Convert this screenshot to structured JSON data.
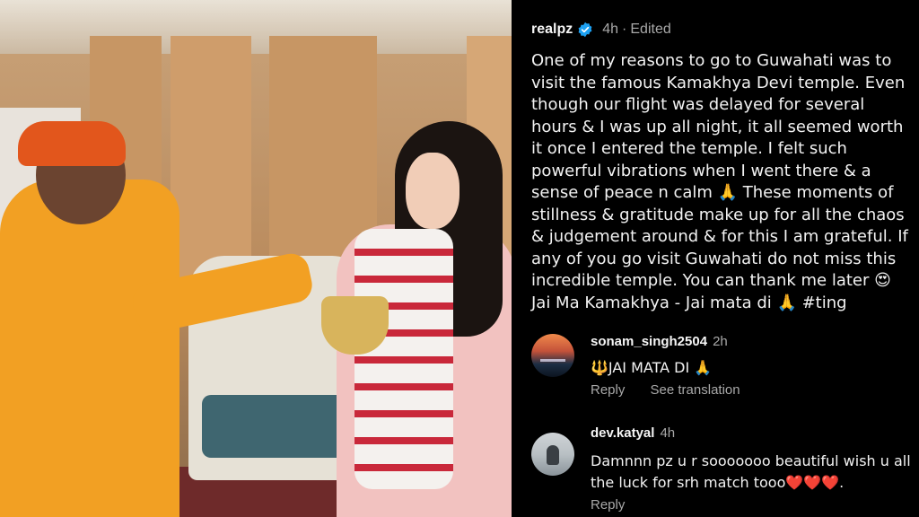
{
  "post": {
    "username": "realpz",
    "time": "4h",
    "dot": "·",
    "edited": "Edited",
    "caption": "One of my reasons to go to Guwahati was to visit the famous Kamakhya Devi temple. Even though our flight was delayed for several hours & I was up all night, it all seemed worth it once I entered the temple. I felt such powerful vibrations when I went there & a sense of peace n calm 🙏 These moments of stillness & gratitude make up for all the chaos & judgement around & for this I am grateful. If any of you go visit Guwahati do not miss this incredible temple. You can thank me later 😍\nJai Ma Kamakhya - Jai mata di 🙏 #ting",
    "verified_icon": "verified-badge-icon",
    "accent_color": "#1da1f2"
  },
  "comments": [
    {
      "username": "sonam_singh2504",
      "time": "2h",
      "text": "🔱JAI MATA DI 🙏",
      "reply_label": "Reply",
      "translation_label": "See translation"
    },
    {
      "username": "dev.katyal",
      "time": "4h",
      "text": "Damnnn pz u r sooooooo beautiful wish u all the luck for srh match tooo❤️❤️❤️.",
      "reply_label": "Reply"
    }
  ]
}
